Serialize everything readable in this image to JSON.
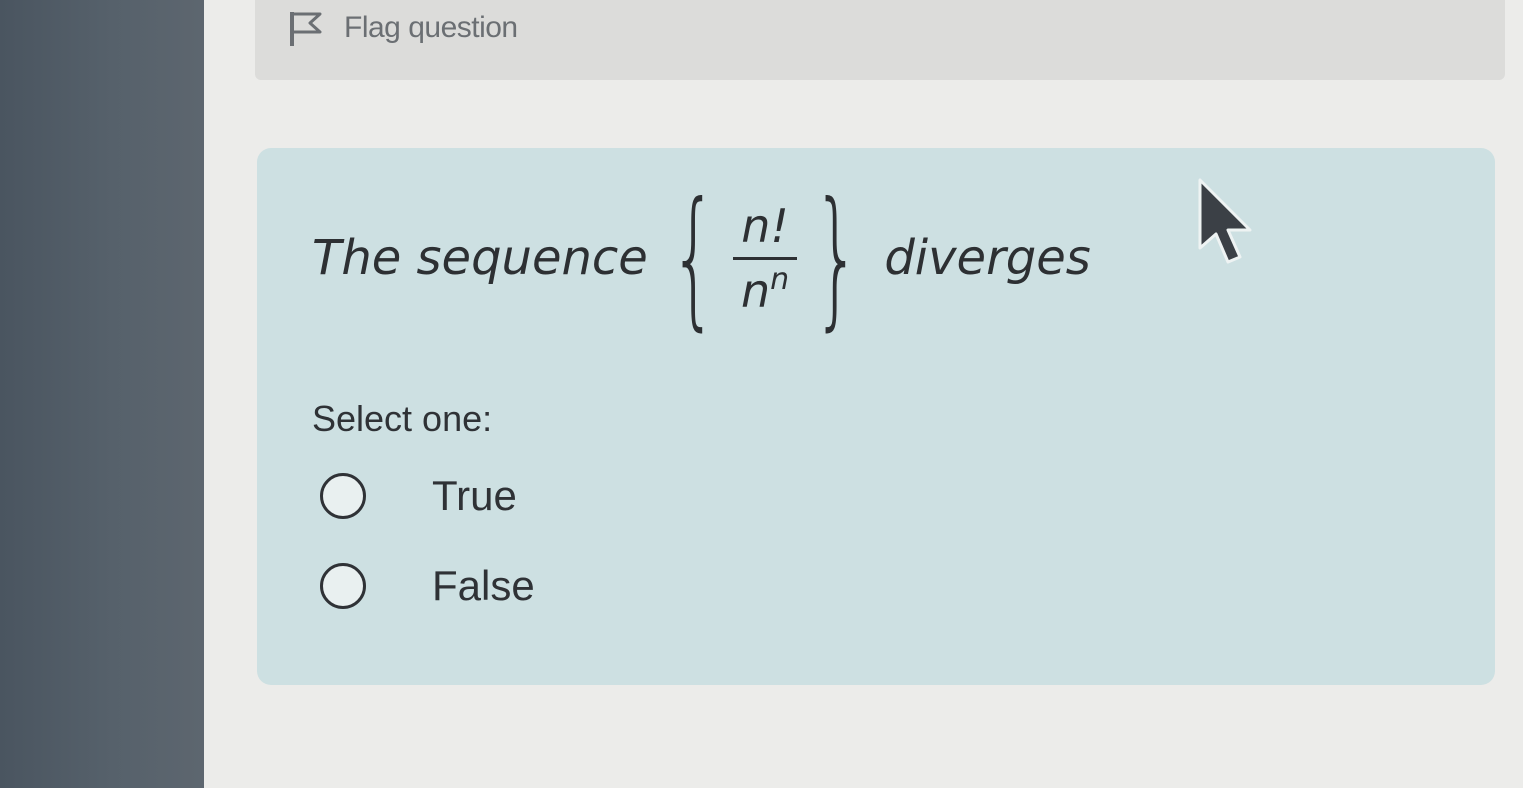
{
  "header": {
    "flag_label": "Flag question",
    "flag_icon": "flag-icon"
  },
  "question": {
    "text_before": "The sequence",
    "numerator": "n!",
    "denominator_base": "n",
    "denominator_exponent": "n",
    "text_after": "diverges",
    "prompt": "Select one:"
  },
  "options": [
    {
      "label": "True",
      "selected": false
    },
    {
      "label": "False",
      "selected": false
    }
  ],
  "colors": {
    "sidebar": "#4a5560",
    "page": "#ececea",
    "question_card": "#cde0e2",
    "text": "#2d3033"
  }
}
